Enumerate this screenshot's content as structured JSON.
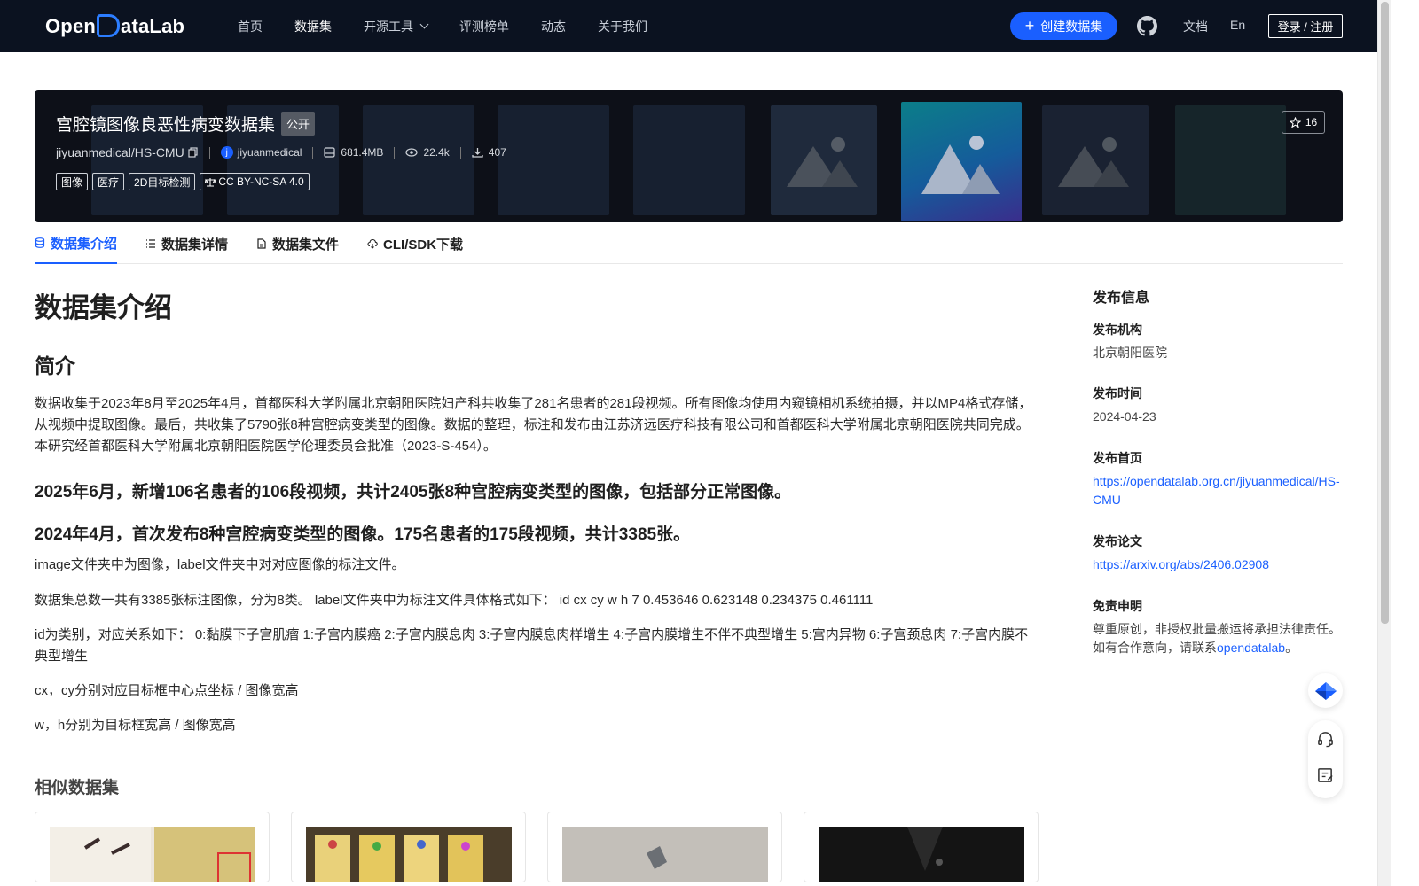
{
  "nav": {
    "logo": "OpenDataLab",
    "logo_left": "Open",
    "logo_right": "ataLab",
    "items": [
      {
        "label": "首页",
        "active": false
      },
      {
        "label": "数据集",
        "active": true
      },
      {
        "label": "开源工具",
        "active": false,
        "dropdown": true
      },
      {
        "label": "评测榜单",
        "active": false
      },
      {
        "label": "动态",
        "active": false
      },
      {
        "label": "关于我们",
        "active": false
      }
    ],
    "create_label": "创建数据集",
    "docs": "文档",
    "lang": "En",
    "login": "登录 / 注册"
  },
  "banner": {
    "title": "宫腔镜图像良恶性病变数据集",
    "visibility": "公开",
    "repo": "jiyuanmedical/HS-CMU",
    "owner": "jiyuanmedical",
    "owner_initial": "j",
    "size": "681.4MB",
    "views": "22.4k",
    "downloads": "407",
    "tags": [
      "图像",
      "医疗",
      "2D目标检测",
      "CC BY-NC-SA 4.0"
    ],
    "stars": "16"
  },
  "tabs": [
    {
      "label": "数据集介绍",
      "active": true
    },
    {
      "label": "数据集详情",
      "active": false
    },
    {
      "label": "数据集文件",
      "active": false
    },
    {
      "label": "CLI/SDK下载",
      "active": false
    }
  ],
  "content": {
    "title": "数据集介绍",
    "intro_heading": "简介",
    "intro_paragraph": "数据收集于2023年8月至2025年4月，首都医科大学附属北京朝阳医院妇产科共收集了281名患者的281段视频。所有图像均使用内窥镜相机系统拍摄，并以MP4格式存储，从视频中提取图像。最后，共收集了5790张8种宫腔病变类型的图像。数据的整理，标注和发布由江苏济远医疗科技有限公司和首都医科大学附属北京朝阳医院共同完成。 本研究经首都医科大学附属北京朝阳医院医学伦理委员会批准（2023-S-454）。",
    "update_2025": "2025年6月，新增106名患者的106段视频，共计2405张8种宫腔病变类型的图像，包括部分正常图像。",
    "update_2024": "2024年4月，首次发布8种宫腔病变类型的图像。175名患者的175段视频，共计3385张。",
    "p1": "image文件夹中为图像，label文件夹中对对应图像的标注文件。",
    "p2": "数据集总数一共有3385张标注图像，分为8类。 label文件夹中为标注文件具体格式如下： id cx cy w h 7 0.453646 0.623148 0.234375 0.461111",
    "p3": "id为类别，对应关系如下： 0:黏膜下子宫肌瘤 1:子宫内膜癌 2:子宫内膜息肉 3:子宫内膜息肉样增生 4:子宫内膜增生不伴不典型增生 5:宫内异物 6:子宫颈息肉 7:子宫内膜不典型增生",
    "p4": "cx，cy分别对应目标框中心点坐标 / 图像宽高",
    "p5": "w，h分别为目标框宽高 / 图像宽高",
    "similar_heading": "相似数据集"
  },
  "sidebar": {
    "title": "发布信息",
    "org_label": "发布机构",
    "org": "北京朝阳医院",
    "date_label": "发布时间",
    "date": "2024-04-23",
    "home_label": "发布首页",
    "home": "https://opendatalab.org.cn/jiyuanmedical/HS-CMU",
    "paper_label": "发布论文",
    "paper": "https://arxiv.org/abs/2406.02908",
    "disclaimer_label": "免责申明",
    "disclaimer_1": "尊重原创，非授权批量搬运将承担法律责任。",
    "disclaimer_2": "如有合作意向，请联系",
    "disclaimer_link": "opendatalab",
    "disclaimer_end": "。"
  },
  "colors": {
    "accent": "#1a5fff",
    "nav_bg": "#0b1220",
    "banner_bg": "#0d1018"
  }
}
